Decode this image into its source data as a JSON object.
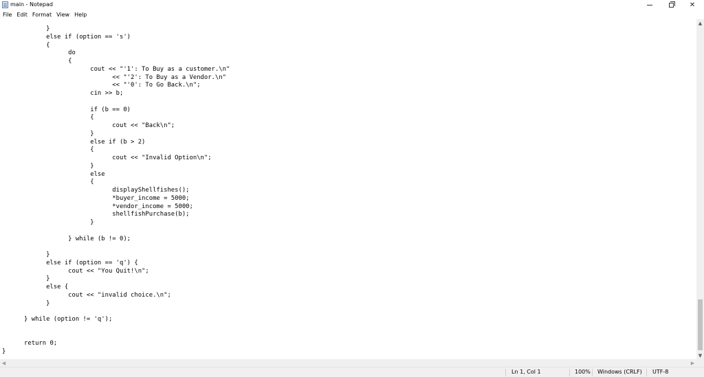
{
  "window": {
    "title": "main - Notepad",
    "minimize_glyph": "",
    "close_glyph": "✕"
  },
  "menu": [
    "File",
    "Edit",
    "Format",
    "View",
    "Help"
  ],
  "editor": {
    "lines": [
      "            }",
      "            else if (option == 's')",
      "            {",
      "                  do",
      "                  {",
      "                        cout << \"'1': To Buy as a customer.\\n\"",
      "                              << \"'2': To Buy as a Vendor.\\n\"",
      "                              << \"'0': To Go Back.\\n\";",
      "                        cin >> b;",
      "",
      "                        if (b == 0)",
      "                        {",
      "                              cout << \"Back\\n\";",
      "                        }",
      "                        else if (b > 2)",
      "                        {",
      "                              cout << \"Invalid Option\\n\";",
      "                        }",
      "                        else",
      "                        {",
      "                              displayShellfishes();",
      "                              *buyer_income = 5000;",
      "                              *vendor_income = 5000;",
      "                              shellfishPurchase(b);",
      "                        }",
      "",
      "                  } while (b != 0);",
      "",
      "            }",
      "            else if (option == 'q') {",
      "                  cout << \"You Quit!\\n\";",
      "            }",
      "            else {",
      "                  cout << \"invalid choice.\\n\";",
      "            }",
      "",
      "      } while (option != 'q');",
      "",
      "",
      "      return 0;",
      "}"
    ]
  },
  "status": {
    "position": "Ln 1, Col 1",
    "zoom": "100%",
    "line_ending": "Windows (CRLF)",
    "encoding": "UTF-8"
  }
}
